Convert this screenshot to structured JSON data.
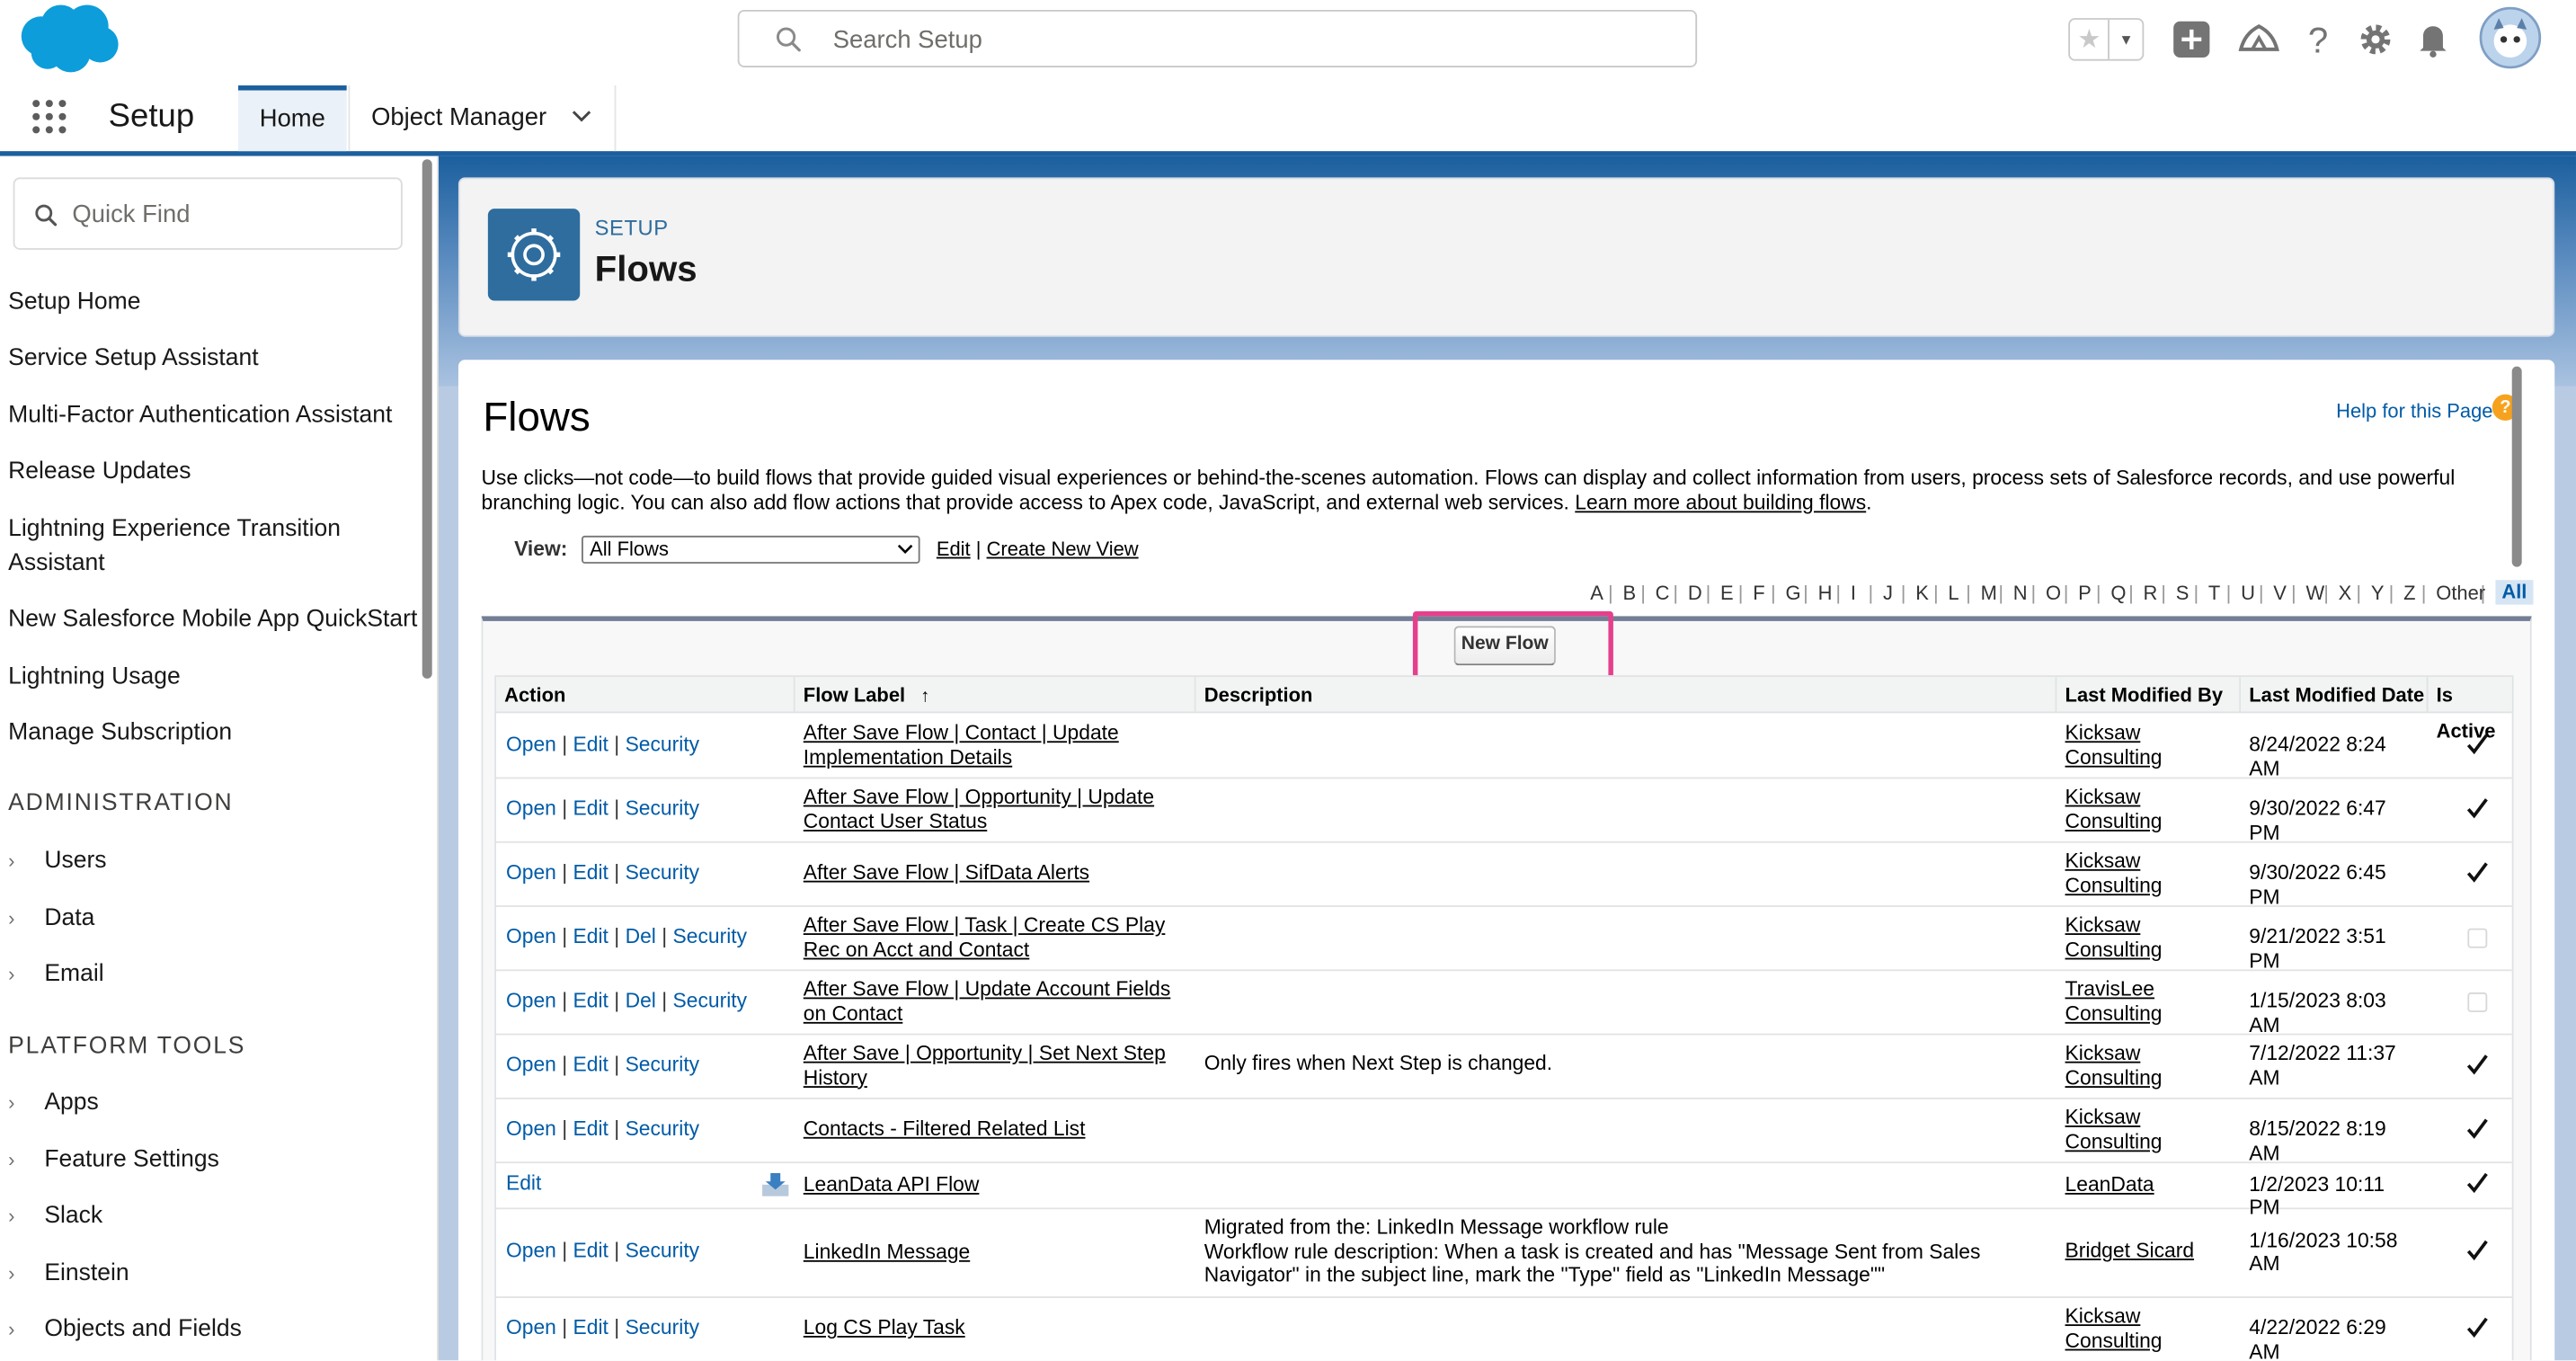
{
  "header": {
    "search_placeholder": "Search Setup"
  },
  "nav": {
    "app_title": "Setup",
    "tabs": [
      {
        "label": "Home"
      },
      {
        "label": "Object Manager"
      }
    ]
  },
  "sidebar": {
    "quick_find_placeholder": "Quick Find",
    "items": [
      "Setup Home",
      "Service Setup Assistant",
      "Multi-Factor Authentication Assistant",
      "Release Updates",
      "Lightning Experience Transition Assistant",
      "New Salesforce Mobile App QuickStart",
      "Lightning Usage",
      "Manage Subscription"
    ],
    "sections": [
      {
        "title": "ADMINISTRATION",
        "items": [
          "Users",
          "Data",
          "Email"
        ]
      },
      {
        "title": "PLATFORM TOOLS",
        "items": [
          "Apps",
          "Feature Settings",
          "Slack",
          "Einstein",
          "Objects and Fields"
        ]
      }
    ]
  },
  "page_header": {
    "kicker": "SETUP",
    "title": "Flows"
  },
  "content": {
    "title": "Flows",
    "help_link": "Help for this Page",
    "description": "Use clicks—not code—to build flows that provide guided visual experiences or behind-the-scenes automation. Flows can display and collect information from users, process sets of Salesforce records, and use powerful branching logic. You can also add flow actions that provide access to Apex code, JavaScript, and external web services.",
    "description_link": "Learn more about building flows",
    "view_label": "View:",
    "view_selected": "All Flows",
    "view_edit": "Edit",
    "view_create": "Create New View",
    "alphabet": [
      "A",
      "B",
      "C",
      "D",
      "E",
      "F",
      "G",
      "H",
      "I",
      "J",
      "K",
      "L",
      "M",
      "N",
      "O",
      "P",
      "Q",
      "R",
      "S",
      "T",
      "U",
      "V",
      "W",
      "X",
      "Y",
      "Z",
      "Other",
      "All"
    ],
    "new_flow_button": "New Flow",
    "columns": [
      "Action",
      "Flow Label",
      "Description",
      "Last Modified By",
      "Last Modified Date",
      "Is Active"
    ],
    "sort_indicator": "↑",
    "rows": [
      {
        "actions": [
          "Open",
          "Edit",
          "Security"
        ],
        "label": "After Save Flow | Contact | Update Implementation Details",
        "description": "",
        "modified_by": "Kicksaw Consulting",
        "modified_date": "8/24/2022 8:24 AM",
        "active": true
      },
      {
        "actions": [
          "Open",
          "Edit",
          "Security"
        ],
        "label": "After Save Flow | Opportunity | Update Contact User Status",
        "description": "",
        "modified_by": "Kicksaw Consulting",
        "modified_date": "9/30/2022 6:47 PM",
        "active": true
      },
      {
        "actions": [
          "Open",
          "Edit",
          "Security"
        ],
        "label": "After Save Flow | SifData Alerts",
        "description": "",
        "modified_by": "Kicksaw Consulting",
        "modified_date": "9/30/2022 6:45 PM",
        "active": true
      },
      {
        "actions": [
          "Open",
          "Edit",
          "Del",
          "Security"
        ],
        "label": "After Save Flow | Task | Create CS Play Rec on Acct and Contact",
        "description": "",
        "modified_by": "Kicksaw Consulting",
        "modified_date": "9/21/2022 3:51 PM",
        "active": false
      },
      {
        "actions": [
          "Open",
          "Edit",
          "Del",
          "Security"
        ],
        "label": "After Save Flow | Update Account Fields on Contact",
        "description": "",
        "modified_by": "TravisLee Consulting",
        "modified_date": "1/15/2023 8:03 AM",
        "active": false
      },
      {
        "actions": [
          "Open",
          "Edit",
          "Security"
        ],
        "label": "After Save | Opportunity | Set Next Step History",
        "description": "Only fires when Next Step is changed.",
        "modified_by": "Kicksaw Consulting",
        "modified_date": "7/12/2022 11:37 AM",
        "active": true
      },
      {
        "actions": [
          "Open",
          "Edit",
          "Security"
        ],
        "label": "Contacts - Filtered Related List",
        "description": "",
        "modified_by": "Kicksaw Consulting",
        "modified_date": "8/15/2022 8:19 AM",
        "active": true
      },
      {
        "actions": [
          "Edit"
        ],
        "label": "LeanData API Flow",
        "description": "",
        "modified_by": "LeanData",
        "modified_date": "1/2/2023 10:11 PM",
        "active": true
      },
      {
        "actions": [
          "Open",
          "Edit",
          "Security"
        ],
        "label": "LinkedIn Message",
        "description": "Migrated from the: LinkedIn Message workflow rule\nWorkflow rule description: When a task is created and has \"Message Sent from Sales Navigator\" in the subject line, mark the \"Type\" field as \"LinkedIn Message\"\"",
        "modified_by": "Bridget Sicard",
        "modified_date": "1/16/2023 10:58 AM",
        "active": true
      },
      {
        "actions": [
          "Open",
          "Edit",
          "Security"
        ],
        "label": "Log CS Play Task",
        "description": "",
        "modified_by": "Kicksaw Consulting",
        "modified_date": "4/22/2022 6:29 AM",
        "active": true
      }
    ]
  },
  "colors": {
    "brand_blue": "#1b5f9e",
    "link_blue": "#015ba7",
    "highlight_pink": "#e6408c"
  }
}
